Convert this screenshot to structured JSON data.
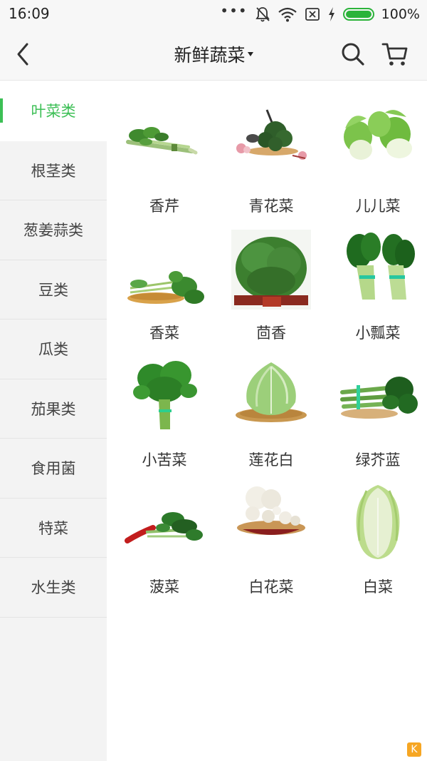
{
  "status": {
    "time": "16:09",
    "battery_pct": "100%",
    "icons": [
      "more-dots-icon",
      "mute-bell-icon",
      "wifi-icon",
      "sim-off-icon",
      "charging-icon",
      "battery-icon"
    ]
  },
  "header": {
    "title": "新鲜蔬菜",
    "back_icon": "chevron-left-icon",
    "search_icon": "search-icon",
    "cart_icon": "cart-icon"
  },
  "sidebar": {
    "items": [
      {
        "label": "叶菜类",
        "active": true
      },
      {
        "label": "根茎类",
        "active": false
      },
      {
        "label": "葱姜蒜类",
        "active": false
      },
      {
        "label": "豆类",
        "active": false
      },
      {
        "label": "瓜类",
        "active": false
      },
      {
        "label": "茄果类",
        "active": false
      },
      {
        "label": "食用菌",
        "active": false
      },
      {
        "label": "特菜",
        "active": false
      },
      {
        "label": "水生类",
        "active": false
      }
    ]
  },
  "products": [
    {
      "name": "香芹"
    },
    {
      "name": "青花菜"
    },
    {
      "name": "儿儿菜"
    },
    {
      "name": "香菜"
    },
    {
      "name": "茴香"
    },
    {
      "name": "小瓢菜"
    },
    {
      "name": "小苦菜"
    },
    {
      "name": "莲花白"
    },
    {
      "name": "绿芥蓝"
    },
    {
      "name": "菠菜"
    },
    {
      "name": "白花菜"
    },
    {
      "name": "白菜"
    }
  ],
  "colors": {
    "accent": "#3cbf55",
    "sidebar_bg": "#f3f3f3",
    "header_bg": "#f7f7f7"
  }
}
